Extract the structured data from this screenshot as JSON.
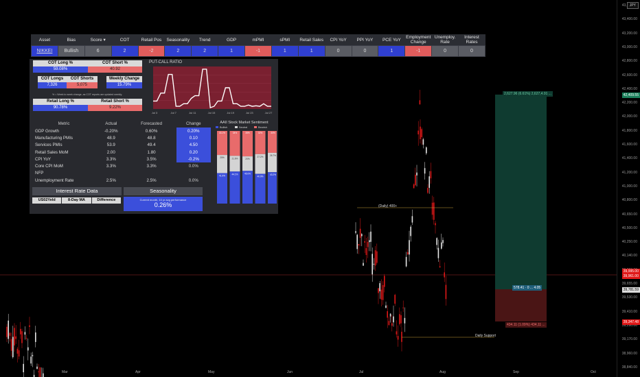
{
  "currency": "JPY",
  "price_axis": [
    "43,600.00",
    "43,400.00",
    "43,200.00",
    "43,000.00",
    "42,800.00",
    "42,600.00",
    "42,400.00",
    "42,200.00",
    "42,000.00",
    "41,800.00",
    "41,600.00",
    "41,400.00",
    "41,200.00",
    "41,000.00",
    "40,800.00",
    "40,650.00",
    "40,500.00",
    "40,250.00",
    "40,140.00",
    "39,900.00",
    "39,655.00",
    "39,530.00",
    "39,410.00",
    "39,290.00",
    "39,170.00",
    "38,960.00",
    "38,840.00"
  ],
  "price_tags": {
    "upper_target": "42,409.55",
    "last_price": "39,995.00",
    "last_price_2": "39,961.00",
    "entry": "39,781.59",
    "stop": "39,347.48"
  },
  "time_axis": [
    "Mar",
    "Apr",
    "May",
    "Jun",
    "Jul",
    "Aug",
    "Sep",
    "Oct"
  ],
  "annotations": {
    "target_text": "2,627.96 (6.61%) 2,627,4.91 ...",
    "entry_text": "578.41 · 0 ... 4.05",
    "stop_text": "434.11 (1.09%) 434,11 ...",
    "daily_level": "(Daily) 400+",
    "daily_support": "Daily Support"
  },
  "top_table": {
    "headers": [
      "Asset",
      "Bias",
      "Score",
      "COT",
      "Retail Pos",
      "Seasonality",
      "Trend",
      "GDP",
      "mPMI",
      "sPMI",
      "Retail Sales",
      "CPI YoY",
      "PPI YoY",
      "PCE YoY",
      "Employment Change",
      "Unemploy. Rate",
      "Interest Rates"
    ],
    "sort_icon": "▾",
    "row": [
      "NIKKEI",
      "Bullish",
      "6",
      "2",
      "-2",
      "2",
      "2",
      "1",
      "-1",
      "1",
      "1",
      "0",
      "0",
      "1",
      "-1",
      "0",
      "0"
    ]
  },
  "cot": {
    "long_label": "COT Long %",
    "long_val": "59.08%",
    "short_label": "COT Short %",
    "short_val": "40.92",
    "longs_label": "COT Longs",
    "longs_val": "7,326",
    "shorts_label": "COT Shorts",
    "shorts_val": "5,075",
    "weekly_label": "Weekly Change",
    "weekly_val": "15.79%",
    "note": "% = Week to week change, as COT reports are updated weekly.",
    "retail_long_label": "Retail Long %",
    "retail_long_val": "90.78%",
    "retail_short_label": "Retail Short %",
    "retail_short_val": "9.22%"
  },
  "pcr": {
    "title": "PUT-CALL RATIO",
    "xlabels": [
      "Jul 3",
      "Jul 7",
      "Jul 11",
      "Jul 15",
      "Jul 19",
      "Jul 23",
      "Jul 27"
    ],
    "values": [
      0.3,
      0.3,
      0.6,
      0.6,
      1.3,
      1.3,
      0.1,
      0.1,
      0.2,
      0.2,
      0.4,
      0.5,
      0.5,
      1.5,
      1.5,
      0.05,
      0.1,
      0.3,
      0.3,
      0.8,
      0.8,
      0.2,
      0.2,
      0.1,
      0.1,
      0.15,
      0.1,
      0.12,
      0.1,
      0.2,
      0.1,
      0.1
    ]
  },
  "metrics": {
    "headers": [
      "Metric",
      "Actual",
      "Forecasted",
      "Change"
    ],
    "rows": [
      [
        "GDP Growth",
        "-0.20%",
        "0.60%",
        "0.20%"
      ],
      [
        "Manufacturing PMIs",
        "48.9",
        "48.8",
        "0.10"
      ],
      [
        "Services PMIs",
        "53.9",
        "49.4",
        "4.50"
      ],
      [
        "Retail Sales MoM",
        "2.00",
        "1.80",
        "0.20"
      ],
      [
        "CPI YoY",
        "3.3%",
        "3.5%",
        "-0.2%"
      ],
      [
        "Core CPI MoM",
        "3.3%",
        "3.3%",
        "0.0%"
      ],
      [
        "NFP",
        "",
        "",
        ""
      ],
      [
        "Unemployment Rate",
        "2.5%",
        "2.5%",
        "0.0%"
      ]
    ]
  },
  "aaii": {
    "title": "AAII Stock Market Sentiment",
    "legend": [
      "Bullish",
      "Neutral",
      "Bearish"
    ],
    "colors": {
      "bullish": "#3b4fdb",
      "neutral": "#d4d4d4",
      "bearish": "#e86b6b"
    },
    "bars": [
      {
        "bull": 41.9,
        "neutral": 25.0,
        "bear": 33.1,
        "bull_label": "41.9%",
        "neutral_label": "25%",
        "bear_label": "33.1%"
      },
      {
        "bull": 44.1,
        "neutral": 21.6,
        "bear": 34.3,
        "bull_label": "44.1%",
        "neutral_label": "21.6%",
        "bear_label": "34%"
      },
      {
        "bull": 45.0,
        "neutral": 20.0,
        "bear": 35.0,
        "bull_label": "45.0%",
        "neutral_label": "20%",
        "bear_label": "35%"
      },
      {
        "bull": 40.9,
        "neutral": 27.2,
        "bear": 31.9,
        "bull_label": "40.9%",
        "neutral_label": "27.2%",
        "bear_label": "32%"
      },
      {
        "bull": 43.2,
        "neutral": 26.7,
        "bear": 30.1,
        "bull_label": "43.2%",
        "neutral_label": "26.7%",
        "bear_label": "30%"
      }
    ]
  },
  "interest_rate": {
    "title": "Interest Rate Data",
    "cols": [
      "US02Yeld",
      "8-Day MA",
      "Difference"
    ]
  },
  "seasonality": {
    "title": "Seasonality",
    "desc": "Current month, 10 yr avg performance",
    "value": "0.26%"
  }
}
